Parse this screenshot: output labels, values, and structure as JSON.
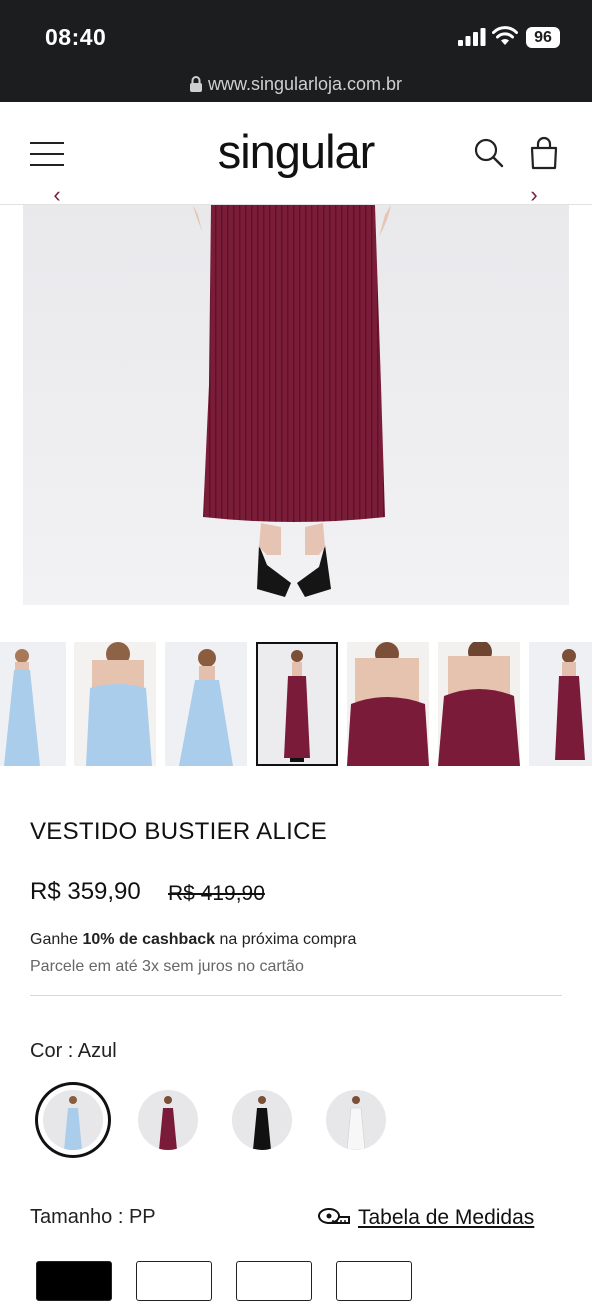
{
  "status_bar": {
    "time": "08:40",
    "battery": "96",
    "url": "www.singularloja.com.br"
  },
  "header": {
    "logo": "singular",
    "menu_icon": "hamburger-icon",
    "search_icon": "search-icon",
    "bag_icon": "shopping-bag-icon"
  },
  "gallery": {
    "prev": "‹",
    "next": "›",
    "selected_thumbnail": 4,
    "thumbnail_count": 7
  },
  "product": {
    "title": "VESTIDO BUSTIER ALICE",
    "price": "R$ 359,90",
    "old_price": "R$ 419,90",
    "cashback_prefix": "Ganhe ",
    "cashback_bold": "10% de cashback",
    "cashback_suffix": " na próxima compra",
    "installments": "Parcele em até 3x sem juros no cartão"
  },
  "color": {
    "label": "Cor : Azul",
    "options": [
      "Azul",
      "Vinho",
      "Preto",
      "Branco"
    ],
    "selected": "Azul"
  },
  "size": {
    "label": "Tamanho : PP",
    "measure_link": "Tabela de Medidas",
    "selected": "PP"
  },
  "colors": {
    "burgundy": "#7a1b3a",
    "light_blue": "#a9cdea",
    "black": "#111111",
    "white": "#f7f7f7",
    "background": "#ebebed"
  }
}
